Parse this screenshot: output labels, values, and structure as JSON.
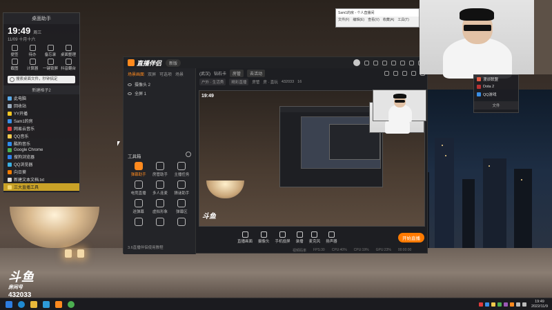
{
  "widget": {
    "title": "桌面助手",
    "time": "19:49",
    "weekday": "周三",
    "date": "11/09 十月十六",
    "tools": [
      "便签",
      "待办",
      "备忘录",
      "桌面整理",
      "截图",
      "计算器",
      "一键锁屏",
      "抖音翻台"
    ],
    "search_placeholder": "搜索桌面文件，秒钟搞定",
    "section_title": "新建格子2",
    "files": [
      "此电脑",
      "回收站",
      "YY开播",
      "Sam1的房",
      "网易云音乐",
      "QQ音乐",
      "酷狗音乐",
      "Google Chrome",
      "搜狗浏览器",
      "QQ浏览器",
      "向日葵",
      "新建文本文档.txt",
      "三大直播工具"
    ]
  },
  "app": {
    "name": "直播伴侣",
    "version": "新版",
    "left_tabs": [
      "场景画面",
      "双屏",
      "可选项",
      "场景"
    ],
    "scenes": [
      "摄像头 2",
      "全屏 1"
    ],
    "tools_title": "工具箱",
    "tools": [
      "弹幕助手",
      "房管助手",
      "主播任务",
      "电竞直播",
      "多人连麦",
      "猜谜助手",
      "送弹幕",
      "虚拟形象",
      "弹幕区",
      "",
      "",
      ""
    ],
    "footer": "3.6直播伴侣使用教程",
    "header_items": [
      "(武汉)",
      "钻石卡",
      "房管",
      "去活动"
    ],
    "sub_items": [
      "户外 · 生活秀",
      "精彩直播",
      "房管",
      "房 · 直玩",
      "432033",
      "16"
    ],
    "preview_time": "19:49",
    "watermark": "斗鱼",
    "controls": [
      "直播画面",
      "摄像头",
      "手机投屏",
      "录播",
      "麦克风",
      "扬声器"
    ],
    "start_label": "开始直播",
    "status": [
      "视频码率",
      "FPS:30",
      "CPU:40%",
      "CPU:19%",
      "GPU:23%",
      "00:00:00"
    ]
  },
  "browser": {
    "title": "Sam1的房 - 个人直播间",
    "menu": [
      "文件(F)",
      "编辑(E)",
      "查看(V)",
      "收藏(A)",
      "工具(T)"
    ]
  },
  "right_panel": {
    "items": [
      "漫谈联盟",
      "Dota 2",
      "QQ游戏"
    ],
    "title": "文件"
  },
  "douyu": {
    "brand": "斗鱼",
    "room_label": "房间号",
    "room": "432033"
  },
  "taskbar": {
    "time": "19:49",
    "date": "2022/11/9"
  },
  "colors": {
    "accent": "#ff8a1e",
    "start_button": "#ff7a00"
  }
}
